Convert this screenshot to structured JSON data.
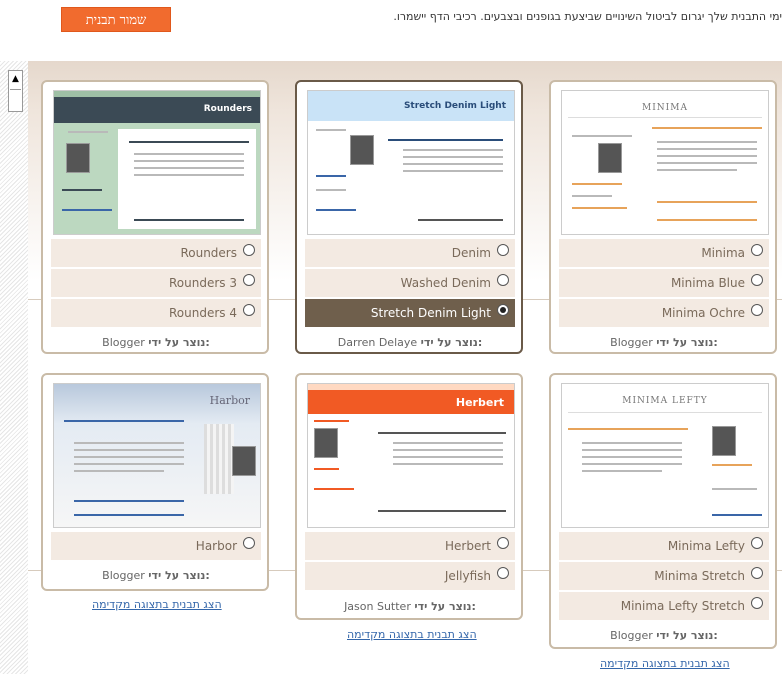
{
  "toolbar": {
    "save_label": "שמור תבנית",
    "note": "ימי התבנית שלך יגרום לביטול השינויים שביצעת בגופנים ובצבעים. רכיבי הדף יישמרו."
  },
  "cards": [
    {
      "id": "minima",
      "thumb_title": "MINIMA",
      "options": [
        {
          "label": "Minima",
          "selected": false
        },
        {
          "label": "Minima Blue",
          "selected": false
        },
        {
          "label": "Minima Ochre",
          "selected": false
        }
      ],
      "creator_prefix": "נוצר על ידי:",
      "creator": "Blogger"
    },
    {
      "id": "stretch-denim",
      "thumb_title": "Stretch Denim Light",
      "options": [
        {
          "label": "Denim",
          "selected": false
        },
        {
          "label": "Washed Denim",
          "selected": false
        },
        {
          "label": "Stretch Denim Light",
          "selected": true
        }
      ],
      "creator_prefix": "נוצר על ידי:",
      "creator": "Darren Delaye"
    },
    {
      "id": "rounders",
      "thumb_title": "Rounders",
      "options": [
        {
          "label": "Rounders",
          "selected": false
        },
        {
          "label": "Rounders 3",
          "selected": false
        },
        {
          "label": "Rounders 4",
          "selected": false
        }
      ],
      "creator_prefix": "נוצר על ידי:",
      "creator": "Blogger"
    },
    {
      "id": "minima-lefty",
      "thumb_title": "MINIMA LEFTY",
      "options": [
        {
          "label": "Minima Lefty",
          "selected": false
        },
        {
          "label": "Minima Stretch",
          "selected": false
        },
        {
          "label": "Minima Lefty Stretch",
          "selected": false
        }
      ],
      "creator_prefix": "נוצר על ידי:",
      "creator": "Blogger",
      "preview_link": "הצג תבנית בתצוגה מקדימה"
    },
    {
      "id": "herbert",
      "thumb_title": "Herbert",
      "options": [
        {
          "label": "Herbert",
          "selected": false
        },
        {
          "label": "Jellyfish",
          "selected": false
        }
      ],
      "creator_prefix": "נוצר על ידי:",
      "creator": "Jason Sutter",
      "preview_link": "הצג תבנית בתצוגה מקדימה"
    },
    {
      "id": "harbor",
      "thumb_title": "Harbor",
      "options": [
        {
          "label": "Harbor",
          "selected": false
        }
      ],
      "creator_prefix": "נוצר על ידי:",
      "creator": "Blogger",
      "preview_link": "הצג תבנית בתצוגה מקדימה"
    }
  ],
  "colors": {
    "accent_button": "#f16b2e",
    "selected_option": "#6f5f4c",
    "option_bg": "#f3eae2",
    "link": "#3366aa"
  }
}
